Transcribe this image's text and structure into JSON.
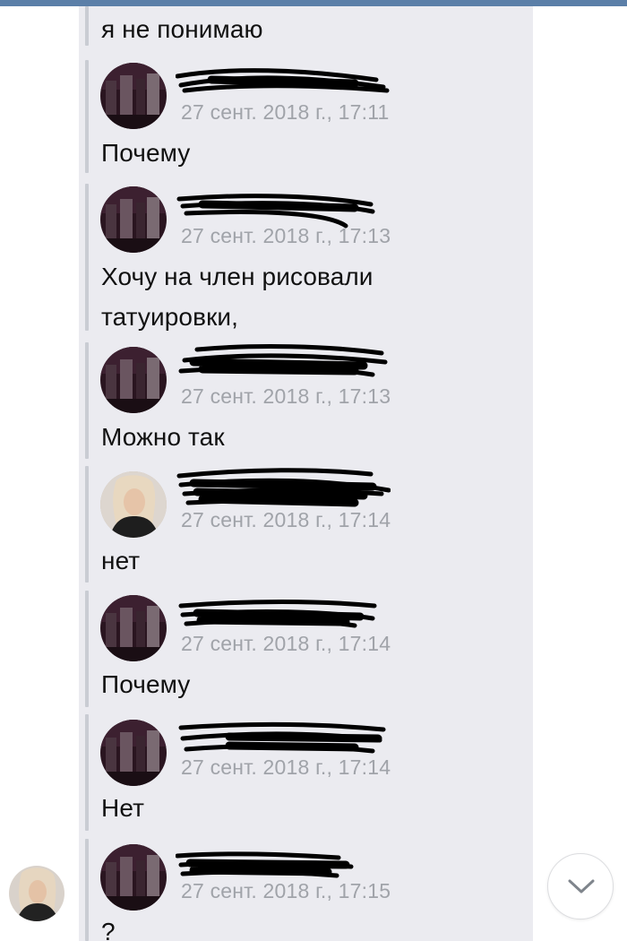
{
  "thread": {
    "first_message": "я не понимаю",
    "messages": [
      {
        "avatar": "dark-group-photo-avatar",
        "time": "27 сент. 2018 г., 17:11",
        "text": [
          "Почему"
        ]
      },
      {
        "avatar": "dark-group-photo-avatar",
        "time": "27 сент. 2018 г., 17:13",
        "text": [
          "Хочу на член рисовали",
          "татуировки,"
        ]
      },
      {
        "avatar": "dark-group-photo-avatar",
        "time": "27 сент. 2018 г., 17:13",
        "text": [
          "Можно так"
        ]
      },
      {
        "avatar": "girl-portrait-avatar",
        "time": "27 сент. 2018 г., 17:14",
        "text": [
          "нет"
        ]
      },
      {
        "avatar": "dark-group-photo-avatar",
        "time": "27 сент. 2018 г., 17:14",
        "text": [
          "Почему"
        ]
      },
      {
        "avatar": "dark-group-photo-avatar",
        "time": "27 сент. 2018 г., 17:14",
        "text": [
          "Нет"
        ]
      },
      {
        "avatar": "dark-group-photo-avatar",
        "time": "27 сент. 2018 г., 17:15",
        "text": [
          "?"
        ]
      }
    ]
  },
  "sender_names_redacted": true,
  "scroll_down_button": {
    "icon": "chevron-down-icon"
  },
  "colors": {
    "top_bar": "#5b7fa8",
    "thread_background": "#ebebf0",
    "quote_bar": "#c9ccd3",
    "timestamp": "#a0a3a9",
    "text": "#111111"
  }
}
